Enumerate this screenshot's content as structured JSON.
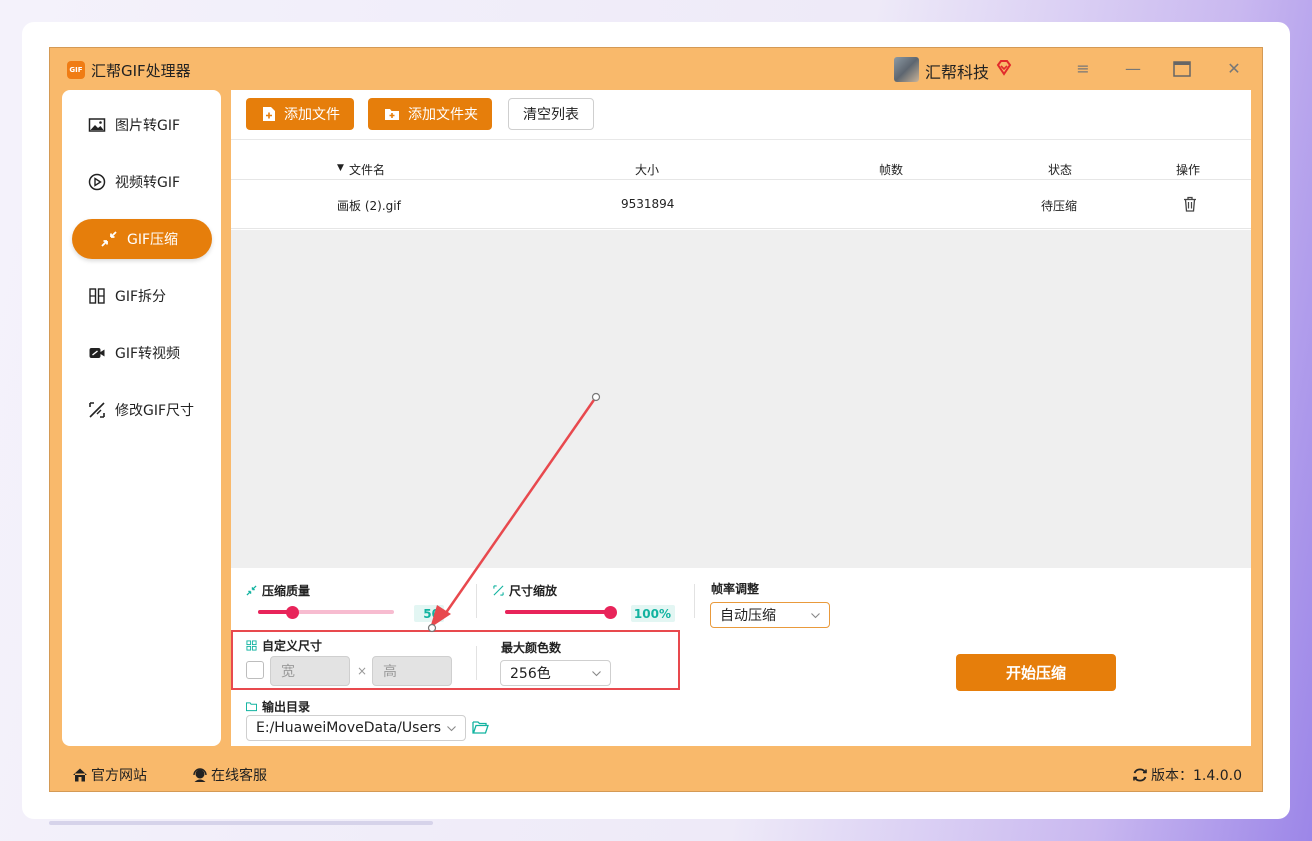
{
  "app": {
    "logo_text": "GIF",
    "title": "汇帮GIF处理器",
    "user_name": "汇帮科技"
  },
  "window_controls": [
    "menu-icon",
    "minimize-icon",
    "maximize-icon",
    "close-icon"
  ],
  "sidebar": {
    "items": [
      {
        "label": "图片转GIF",
        "icon": "image-icon",
        "active": false
      },
      {
        "label": "视频转GIF",
        "icon": "play-icon",
        "active": false
      },
      {
        "label": "GIF压缩",
        "icon": "compress-icon",
        "active": true
      },
      {
        "label": "GIF拆分",
        "icon": "split-icon",
        "active": false
      },
      {
        "label": "GIF转视频",
        "icon": "video-icon",
        "active": false
      },
      {
        "label": "修改GIF尺寸",
        "icon": "resize-icon",
        "active": false
      }
    ]
  },
  "toolbar": {
    "add_file": "添加文件",
    "add_folder": "添加文件夹",
    "clear_list": "清空列表"
  },
  "table": {
    "columns": [
      "文件名",
      "大小",
      "帧数",
      "状态",
      "操作"
    ],
    "rows": [
      {
        "name": "画板 (2).gif",
        "size": "9531894",
        "frames": "",
        "status": "待压缩"
      }
    ]
  },
  "settings": {
    "quality_label": "压缩质量",
    "quality_value": "50",
    "quality_level": 0.5,
    "scale_label": "尺寸缩放",
    "scale_value": "100%",
    "scale_level": 1.0,
    "framerate_label": "帧率调整",
    "framerate_selected": "自动压缩",
    "custom_size_label": "自定义尺寸",
    "width_placeholder": "宽",
    "times": "×",
    "height_placeholder": "高",
    "max_colors_label": "最大颜色数",
    "max_colors_selected": "256色",
    "output_label": "输出目录",
    "output_path": "E:/HuaweiMoveData/Users",
    "start_button": "开始压缩"
  },
  "statusbar": {
    "website": "官方网站",
    "support": "在线客服",
    "version": "版本：1.4.0.0"
  },
  "colors": {
    "accent": "#e67e0b",
    "window_bg": "#f9b96b",
    "slider_thumb": "#e8245a",
    "badge_text": "#12b3a0",
    "annotation": "#e8494e"
  }
}
